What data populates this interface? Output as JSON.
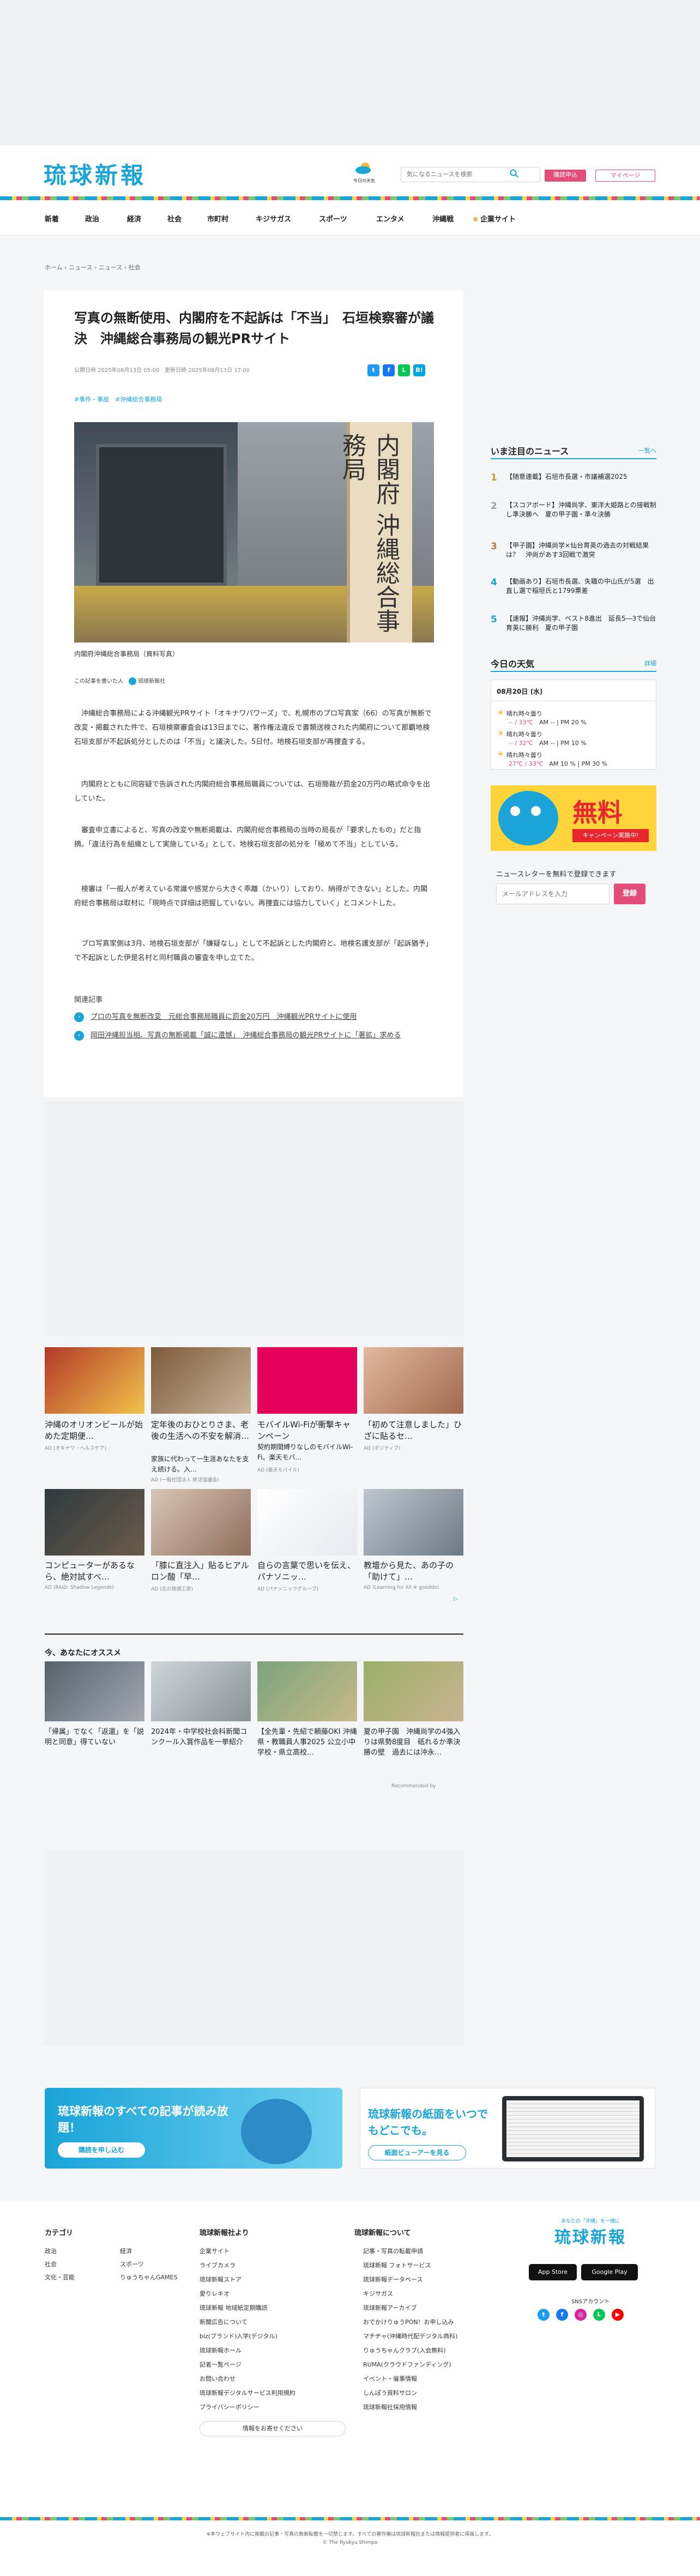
{
  "header": {
    "logo": "琉球新報",
    "weather_label": "今日の天気",
    "search_placeholder": "気になるニュースを検索",
    "subscribe_btn": "購読申込",
    "mypage_btn": "マイページ"
  },
  "nav": [
    "新着",
    "政治",
    "経済",
    "社会",
    "市町村",
    "キジサガス",
    "スポーツ",
    "エンタメ",
    "沖縄戦",
    "企業サイト"
  ],
  "breadcrumb": [
    "ホーム",
    "ニュース",
    "ニュース",
    "社会"
  ],
  "article": {
    "title": "写真の無断使用、内閣府を不起訴は「不当」　石垣検察審が議決　沖縄総合事務局の観光PRサイト",
    "published": "公開日時 2025年08月13日 05:00",
    "updated": "更新日時 2025年08月13日 17:00",
    "tags": [
      "#事件・事故",
      "#沖縄総合事務局"
    ],
    "photo_sign": "内閣府 沖縄総合事務局",
    "caption": "内閣府沖縄総合事務局（資料写真）",
    "author_label": "この記事を書いた人",
    "author_name": "琉球新報社",
    "paragraphs": [
      "沖縄総合事務局による沖縄観光PRサイト「オキナワパワーズ」で、札幌市のプロ写真家（66）の写真が無断で改変・掲載された件で、石垣検察審査会は13日までに、著作権法違反で書類送検された内閣府について那覇地検石垣支部が不起訴処分としたのは「不当」と議決した。5日付。地検石垣支部が再捜査する。",
      "内閣府とともに同容疑で告訴された内閣府総合事務局職員については、石垣簡裁が罰金20万円の略式命令を出していた。",
      "審査申立書によると、写真の改変や無断掲載は、内閣府総合事務局の当時の局長が「要求したもの」だと指摘。「違法行為を組織として実施している」として、地検石垣支部の処分を「極めて不当」としている。",
      "検審は「一般人が考えている常識や感覚から大きく乖離（かいり）しており、納得ができない」とした。内閣府総合事務局は取材に「現時点で詳細は把握していない。再捜査には協力していく」とコメントした。",
      "プロ写真家側は3月、地検石垣支部が「嫌疑なし」として不起訴とした内閣府と、地検名護支部が「起訴猶予」で不起訴とした伊是名村と同村職員の審査を申し立てた。"
    ],
    "related_heading": "関連記事",
    "related": [
      "プロの写真を無断改変　元総合事務局職員に罰金20万円　沖縄観光PRサイトに使用",
      "岡田沖縄担当相、写真の無断掲載「誠に遺憾」　沖縄総合事務局の観光PRサイトに「著拡」求める"
    ]
  },
  "sidebar": {
    "popular_heading": "いま注目のニュース",
    "popular_more": "一覧へ",
    "popular": [
      {
        "rank": "1",
        "text": "【随意連載】石垣市長選・市議補選2025"
      },
      {
        "rank": "2",
        "text": "【スコアボード】沖縄尚学、東洋大姫路との接戦制し準決勝へ　夏の甲子園・準々決勝"
      },
      {
        "rank": "3",
        "text": "【甲子園】沖縄尚学×仙台育英の過去の対戦結果は？　沖尚があす3回戦で激突"
      },
      {
        "rank": "4",
        "text": "【動画あり】石垣市長選、失職の中山氏が5選　出直し選で稲垣氏と1799票差"
      },
      {
        "rank": "5",
        "text": "【速報】沖縄尚学、ベスト8進出　延長5―3で仙台育英に勝利　夏の甲子園"
      }
    ],
    "weather_heading": "今日の天気",
    "weather_more": "詳細",
    "weather_date": "08月20日 (水)",
    "weather_rows": [
      {
        "region": "晴れ時々曇り",
        "temp": "-- / 33℃",
        "rain": "AM -- | PM 20 %"
      },
      {
        "region": "晴れ時々曇り",
        "temp": "-- / 32℃",
        "rain": "AM -- | PM 10 %"
      },
      {
        "region": "晴れ時々曇り",
        "temp": "27℃ / 33℃",
        "rain": "AM 10 % | PM 30 %"
      }
    ],
    "ad_text": "無料",
    "ad_sub": "キャンペーン実施中!",
    "newsletter_label": "ニュースレターを無料で登録できます",
    "newsletter_placeholder": "メールアドレスを入力",
    "newsletter_btn": "登録"
  },
  "promos": [
    {
      "title": "沖縄のオリオンビールが始めた定期便…",
      "src": "AD (オキナワ・ヘルスケア)"
    },
    {
      "title": "定年後のおひとりさま、老後の生活への不安を解消…",
      "sub": "家族に代わって一生涯あなたを支え続ける。入…",
      "src": "AD (一般社団法人 終活協議会)"
    },
    {
      "title": "モバイルWi-Fiが衝撃キャンペーン",
      "sub": "契約期間縛りなしのモバイルWi-Fi。楽天モバ…",
      "src": "AD (楽天モバイル)"
    },
    {
      "title": "「初めて注意しました」ひざに貼るセ…",
      "src": "AD (ポジティブ)"
    },
    {
      "title": "コンピューターがあるなら、絶対試すべ…",
      "src": "AD (RAID: Shadow Legends)"
    },
    {
      "title": "「膝に直注入」貼るヒアルロン酸「早…",
      "src": "AD (北の快適工房)"
    },
    {
      "title": "自らの言葉で思いを伝え、パナソニッ…",
      "src": "AD (パナソニックグループ)"
    },
    {
      "title": "教壇から見た、あの子の「助けて」…",
      "src": "AD (Learning for All ※ gooddo)"
    }
  ],
  "osusume": {
    "heading": "今、あなたにオススメ",
    "items": [
      "「帰属」でなく「返還」を「説明と同意」得ていない",
      "2024年・中学校社会科新聞コンクール入賞作品を一挙紹介",
      "【全先輩・先紹で頼藤OKI 沖縄県・教職員人事2025 公立小中学校・県立高校…",
      "夏の甲子園　沖縄尚学の4強入りは県勢8度目　砥れるか準決勝の壁　過去には沖永…"
    ],
    "recommended_by": "Recommended by"
  },
  "banners": {
    "left_title": "琉球新報のすべての記事が読み放題！",
    "left_btn": "購読を申し込む",
    "right_title": "琉球新報の紙面をいつでもどこでも。",
    "right_btn": "紙面ビューアーを見る"
  },
  "footer": {
    "cat_heading": "カテゴリ",
    "cats": [
      "政治",
      "社会",
      "文化・芸能",
      "経済",
      "スポーツ",
      "りゅうちゃんGAMES"
    ],
    "about_heading": "琉球新報社より",
    "about": [
      "企業サイト",
      "ライブカメラ",
      "琉球新報ストア",
      "愛りレキオ",
      "琉球新報 地域紙定期購読",
      "新聞広告について",
      "biz(ブランド)入学(デジタル)",
      "琉球新報ホール",
      "記者一覧ページ",
      "お問い合わせ",
      "琉球新報デジタルサービス利用規約",
      "プライバシーポリシー"
    ],
    "more_btn": "情報をお寄せください",
    "about2_heading": "琉球新報について",
    "about2": [
      "記事・写真の転載申請",
      "琉球新報 フォトサービス",
      "琉球新報データベース",
      "キジサガス",
      "琉球新報アーカイブ",
      "おでかけりゅうPON！お申し込み",
      "マチヂャ(沖縄時代配デジタル商科)",
      "りゅうちゃんクラブ(入会無料)",
      "RUMA(クラウドファンディング)",
      "イベント・催事情報",
      "しんぽう資料サロン",
      "琉球新報社採用情報"
    ],
    "tagline": "あなたの「沖縄」を一緒に",
    "logo": "琉球新報",
    "app_store": "App Store",
    "google_play": "Google Play",
    "sns_label": "SNSアカウント",
    "copyright_note": "※本ウェブサイト内に掲載の記事・写真の無断転載を一切禁じます。すべての著作権は琉球新報社または情報提供者に帰属します。",
    "copyright": "© The Ryukyu Shimpo"
  },
  "colors": {
    "brand": "#1aa4d8",
    "accent": "#e44d7a"
  }
}
